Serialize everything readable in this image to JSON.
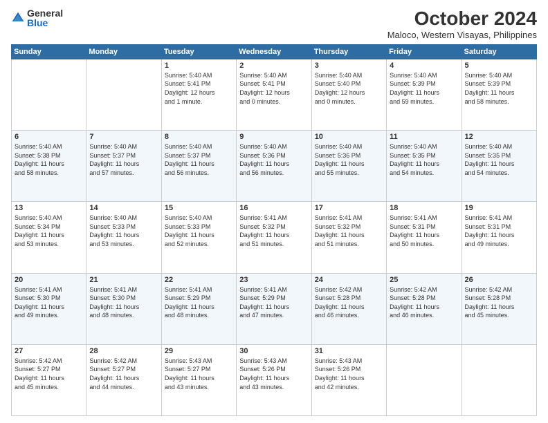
{
  "logo": {
    "general": "General",
    "blue": "Blue"
  },
  "header": {
    "month": "October 2024",
    "location": "Maloco, Western Visayas, Philippines"
  },
  "weekdays": [
    "Sunday",
    "Monday",
    "Tuesday",
    "Wednesday",
    "Thursday",
    "Friday",
    "Saturday"
  ],
  "weeks": [
    [
      {
        "day": "",
        "info": ""
      },
      {
        "day": "",
        "info": ""
      },
      {
        "day": "1",
        "info": "Sunrise: 5:40 AM\nSunset: 5:41 PM\nDaylight: 12 hours\nand 1 minute."
      },
      {
        "day": "2",
        "info": "Sunrise: 5:40 AM\nSunset: 5:41 PM\nDaylight: 12 hours\nand 0 minutes."
      },
      {
        "day": "3",
        "info": "Sunrise: 5:40 AM\nSunset: 5:40 PM\nDaylight: 12 hours\nand 0 minutes."
      },
      {
        "day": "4",
        "info": "Sunrise: 5:40 AM\nSunset: 5:39 PM\nDaylight: 11 hours\nand 59 minutes."
      },
      {
        "day": "5",
        "info": "Sunrise: 5:40 AM\nSunset: 5:39 PM\nDaylight: 11 hours\nand 58 minutes."
      }
    ],
    [
      {
        "day": "6",
        "info": "Sunrise: 5:40 AM\nSunset: 5:38 PM\nDaylight: 11 hours\nand 58 minutes."
      },
      {
        "day": "7",
        "info": "Sunrise: 5:40 AM\nSunset: 5:37 PM\nDaylight: 11 hours\nand 57 minutes."
      },
      {
        "day": "8",
        "info": "Sunrise: 5:40 AM\nSunset: 5:37 PM\nDaylight: 11 hours\nand 56 minutes."
      },
      {
        "day": "9",
        "info": "Sunrise: 5:40 AM\nSunset: 5:36 PM\nDaylight: 11 hours\nand 56 minutes."
      },
      {
        "day": "10",
        "info": "Sunrise: 5:40 AM\nSunset: 5:36 PM\nDaylight: 11 hours\nand 55 minutes."
      },
      {
        "day": "11",
        "info": "Sunrise: 5:40 AM\nSunset: 5:35 PM\nDaylight: 11 hours\nand 54 minutes."
      },
      {
        "day": "12",
        "info": "Sunrise: 5:40 AM\nSunset: 5:35 PM\nDaylight: 11 hours\nand 54 minutes."
      }
    ],
    [
      {
        "day": "13",
        "info": "Sunrise: 5:40 AM\nSunset: 5:34 PM\nDaylight: 11 hours\nand 53 minutes."
      },
      {
        "day": "14",
        "info": "Sunrise: 5:40 AM\nSunset: 5:33 PM\nDaylight: 11 hours\nand 53 minutes."
      },
      {
        "day": "15",
        "info": "Sunrise: 5:40 AM\nSunset: 5:33 PM\nDaylight: 11 hours\nand 52 minutes."
      },
      {
        "day": "16",
        "info": "Sunrise: 5:41 AM\nSunset: 5:32 PM\nDaylight: 11 hours\nand 51 minutes."
      },
      {
        "day": "17",
        "info": "Sunrise: 5:41 AM\nSunset: 5:32 PM\nDaylight: 11 hours\nand 51 minutes."
      },
      {
        "day": "18",
        "info": "Sunrise: 5:41 AM\nSunset: 5:31 PM\nDaylight: 11 hours\nand 50 minutes."
      },
      {
        "day": "19",
        "info": "Sunrise: 5:41 AM\nSunset: 5:31 PM\nDaylight: 11 hours\nand 49 minutes."
      }
    ],
    [
      {
        "day": "20",
        "info": "Sunrise: 5:41 AM\nSunset: 5:30 PM\nDaylight: 11 hours\nand 49 minutes."
      },
      {
        "day": "21",
        "info": "Sunrise: 5:41 AM\nSunset: 5:30 PM\nDaylight: 11 hours\nand 48 minutes."
      },
      {
        "day": "22",
        "info": "Sunrise: 5:41 AM\nSunset: 5:29 PM\nDaylight: 11 hours\nand 48 minutes."
      },
      {
        "day": "23",
        "info": "Sunrise: 5:41 AM\nSunset: 5:29 PM\nDaylight: 11 hours\nand 47 minutes."
      },
      {
        "day": "24",
        "info": "Sunrise: 5:42 AM\nSunset: 5:28 PM\nDaylight: 11 hours\nand 46 minutes."
      },
      {
        "day": "25",
        "info": "Sunrise: 5:42 AM\nSunset: 5:28 PM\nDaylight: 11 hours\nand 46 minutes."
      },
      {
        "day": "26",
        "info": "Sunrise: 5:42 AM\nSunset: 5:28 PM\nDaylight: 11 hours\nand 45 minutes."
      }
    ],
    [
      {
        "day": "27",
        "info": "Sunrise: 5:42 AM\nSunset: 5:27 PM\nDaylight: 11 hours\nand 45 minutes."
      },
      {
        "day": "28",
        "info": "Sunrise: 5:42 AM\nSunset: 5:27 PM\nDaylight: 11 hours\nand 44 minutes."
      },
      {
        "day": "29",
        "info": "Sunrise: 5:43 AM\nSunset: 5:27 PM\nDaylight: 11 hours\nand 43 minutes."
      },
      {
        "day": "30",
        "info": "Sunrise: 5:43 AM\nSunset: 5:26 PM\nDaylight: 11 hours\nand 43 minutes."
      },
      {
        "day": "31",
        "info": "Sunrise: 5:43 AM\nSunset: 5:26 PM\nDaylight: 11 hours\nand 42 minutes."
      },
      {
        "day": "",
        "info": ""
      },
      {
        "day": "",
        "info": ""
      }
    ]
  ]
}
